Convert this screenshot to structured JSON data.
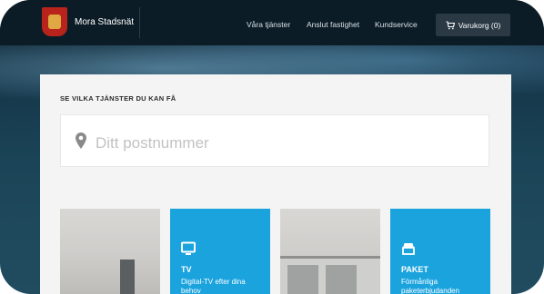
{
  "header": {
    "brand": "Mora Stadsnät",
    "nav": [
      "Våra tjänster",
      "Anslut fastighet",
      "Kundservice"
    ],
    "cart_label": "Varukorg (0)"
  },
  "search": {
    "title": "SE VILKA TJÄNSTER DU KAN FÅ",
    "placeholder": "Ditt postnummer"
  },
  "tiles": [
    {
      "kind": "photo"
    },
    {
      "kind": "service",
      "icon": "tv-icon",
      "title": "TV",
      "description": "Digital-TV efter dina behov"
    },
    {
      "kind": "photo"
    },
    {
      "kind": "service",
      "icon": "package-icon",
      "title": "PAKET",
      "description": "Förmånliga paketerbjudanden"
    }
  ],
  "colors": {
    "accent": "#1ba3de",
    "navbar": "#0c1c26",
    "cart_bg": "#2a3944"
  }
}
